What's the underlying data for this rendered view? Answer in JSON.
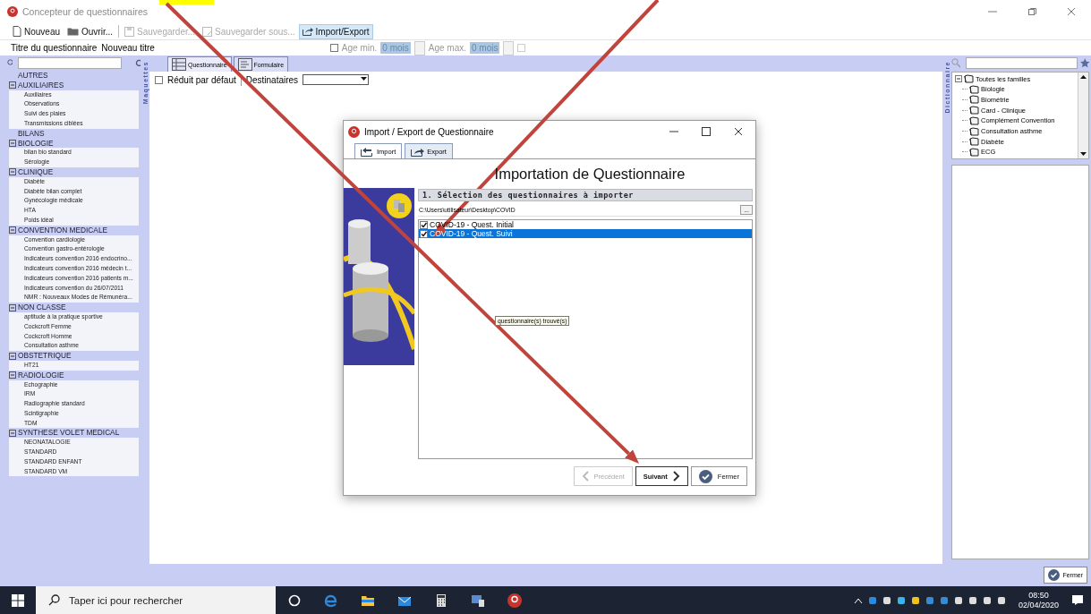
{
  "window": {
    "title": "Concepteur de questionnaires"
  },
  "toolbar": [
    {
      "kind": "new",
      "label": "Nouveau",
      "disabled": false,
      "selected": false
    },
    {
      "kind": "open",
      "label": "Ouvrir...",
      "disabled": false,
      "selected": false
    },
    {
      "kind": "save",
      "label": "Sauvegarder...",
      "disabled": true,
      "selected": false
    },
    {
      "kind": "save-as",
      "label": "Sauvegarder sous...",
      "disabled": true,
      "selected": false
    },
    {
      "kind": "import-export",
      "label": "Import/Export",
      "disabled": false,
      "selected": true
    }
  ],
  "title_row": {
    "label": "Titre du questionnaire",
    "value": "Nouveau titre"
  },
  "age": {
    "checked": false,
    "min_label": "Age min.",
    "min_value": "0 mois",
    "max_label": "Age max.",
    "max_value": "0 mois"
  },
  "left_panel": {
    "side_label": "Maquettes",
    "groups": [
      {
        "label": "AUTRES"
      },
      {
        "label": "AUXILIAIRES",
        "expanded": true,
        "children": [
          "Auxiliaires",
          "Observations",
          "Suivi des plaies",
          "Transmissions ciblées"
        ]
      },
      {
        "label": "BILANS"
      },
      {
        "label": "BIOLOGIE",
        "expanded": true,
        "children": [
          "bilan bio standard",
          "Sérologie"
        ]
      },
      {
        "label": "CLINIQUE",
        "expanded": true,
        "children": [
          "Diabète",
          "Diabète bilan complet",
          "Gynécologie médicale",
          "HTA",
          "Poids idéal"
        ]
      },
      {
        "label": "CONVENTION MEDICALE",
        "expanded": true,
        "children": [
          "Convention cardiologie",
          "Convention gastro-entérologie",
          "Indicateurs convention 2016 endocrino...",
          "Indicateurs convention 2016 médecin t...",
          "Indicateurs convention 2016 patients m...",
          "Indicateurs convention du 26/07/2011",
          "NMR : Nouveaux Modes de Rémunéra..."
        ]
      },
      {
        "label": "NON CLASSE",
        "expanded": true,
        "children": [
          "aptitude à la pratique sportive",
          "Cockcroft Femme",
          "Cockcroft Homme",
          "Consultation asthme"
        ]
      },
      {
        "label": "OBSTETRIQUE",
        "expanded": true,
        "children": [
          "HT21"
        ]
      },
      {
        "label": "RADIOLOGIE",
        "expanded": true,
        "children": [
          "Echographie",
          "IRM",
          "Radiographie standard",
          "Scintigraphie",
          "TDM"
        ]
      },
      {
        "label": "SYNTHESE VOLET MEDICAL",
        "expanded": true,
        "children": [
          "NEONATALOGIE",
          "STANDARD",
          "STANDARD ENFANT",
          "STANDARD VM"
        ]
      }
    ]
  },
  "tabs": [
    {
      "label": "Questionnaire",
      "selected": true
    },
    {
      "label": "Formulaire",
      "selected": false
    }
  ],
  "form": {
    "reduced": {
      "label": "Réduit par défaut",
      "checked": false
    },
    "recipients": {
      "label": "Destinataires"
    }
  },
  "right_panel": {
    "side_label": "Dictionnaire",
    "tree": {
      "label": "Toutes les familles",
      "expanded": true,
      "children": [
        "Biologie",
        "Biométrie",
        "Card - Clinique",
        "Complément Convention",
        "Consultation asthme",
        "Diabète",
        "ECG"
      ]
    },
    "close_button": "Fermer"
  },
  "dialog": {
    "title": "Import / Export de Questionnaire",
    "tabs": [
      {
        "label": "Import",
        "selected": true
      },
      {
        "label": "Export",
        "selected": false
      }
    ],
    "heading": "Importation de Questionnaire",
    "section": "1. Sélection des questionnaires à importer",
    "path": "C:\\Users\\utilisateur\\Desktop\\COVID",
    "browse": "...",
    "items": [
      {
        "label": "COVID-19 - Quest. Initial",
        "checked": true,
        "selected": false
      },
      {
        "label": "COVID-19 - Quest. Suivi",
        "checked": true,
        "selected": true
      }
    ],
    "tooltip": "questionnaire(s) trouvé(s)",
    "buttons": [
      {
        "kind": "previous",
        "label": "Précédent",
        "disabled": true
      },
      {
        "kind": "next",
        "label": "Suivant",
        "disabled": false
      },
      {
        "kind": "close",
        "label": "Fermer",
        "disabled": false
      }
    ]
  },
  "taskbar": {
    "search_placeholder": "Taper ici pour rechercher",
    "time": "08:50",
    "date": "02/04/2020"
  }
}
